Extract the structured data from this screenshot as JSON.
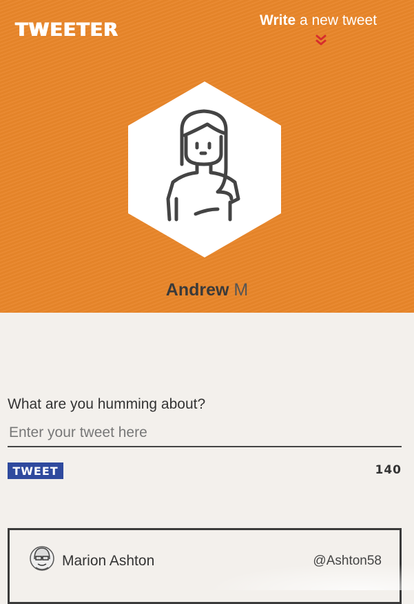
{
  "header": {
    "logo": "TWEETER",
    "write_link": {
      "bold": "Write",
      "rest": " a new tweet"
    },
    "chevron_icon": "double-chevron-down-icon",
    "avatar_icon": "user-avatar-icon"
  },
  "profile": {
    "first_name": "Andrew",
    "last_name": "M"
  },
  "compose": {
    "prompt": "What are you humming about?",
    "placeholder": "Enter your tweet here",
    "button_label": "TWEET",
    "char_count": "140"
  },
  "feed": [
    {
      "name": "Marion Ashton",
      "handle": "@Ashton58",
      "avatar_icon": "user-avatar-icon"
    }
  ],
  "colors": {
    "header_bg": "#e8862a",
    "page_bg": "#f3f0ec",
    "button_bg": "#2f4a9e",
    "chevron": "#d62d2d"
  }
}
